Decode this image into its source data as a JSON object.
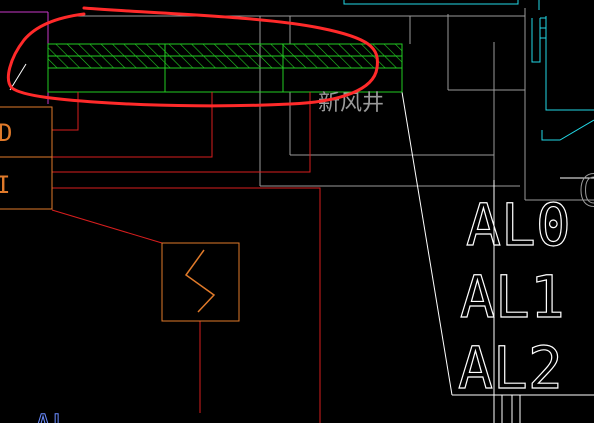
{
  "app": {
    "type": "cad-drawing-viewport"
  },
  "labels": {
    "shaft_label": "新风井",
    "al0": "AL0",
    "al1": "AL1",
    "al2": "AL2",
    "bottom_label": "AL",
    "right_edge_label": "C",
    "box_upper_label": "D",
    "box_lower_label": "I"
  },
  "colors": {
    "background": "#000000",
    "red_markup": "#ff2a2a",
    "green_hatch": "#22cc22",
    "orange": "#e07a2a",
    "red_lines": "#d81e1e",
    "white": "#ffffff",
    "gray": "#9a9a9a",
    "cyan": "#22d8e6",
    "magenta": "#c838c8"
  }
}
